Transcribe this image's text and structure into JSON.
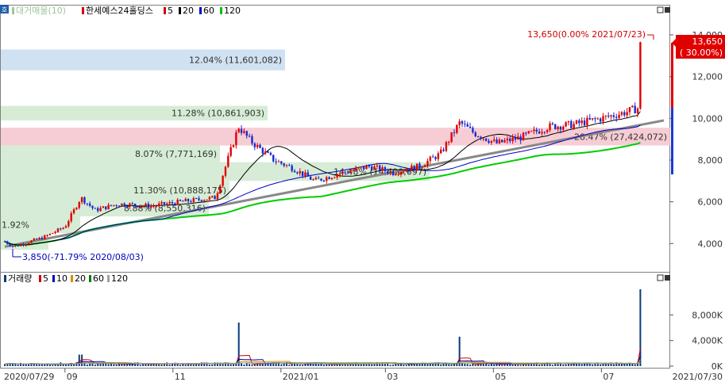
{
  "price_pane": {
    "legend": [
      {
        "label": "대거매물(10)",
        "color": "#9cc79c"
      },
      {
        "label": "한세예스24홀딩스",
        "color": "#d00000"
      },
      {
        "label": "5",
        "color": "#d00000"
      },
      {
        "label": "20",
        "color": "#000000"
      },
      {
        "label": "60",
        "color": "#0000c0"
      },
      {
        "label": "120",
        "color": "#00c000"
      }
    ],
    "badge": "호",
    "high_annotation": "13,650(0.00% 2021/07/23)",
    "low_annotation": "3,850(-71.79% 2020/08/03)",
    "last_price_box": {
      "price": "13,650",
      "change": "( 30.00%)"
    },
    "y_ticks": [
      "14,000",
      "12,000",
      "10,000",
      "8,000",
      "6,000",
      "4,000"
    ]
  },
  "volume_pane": {
    "legend": [
      {
        "label": "거래량",
        "color": "#0a3a7a"
      },
      {
        "label": "5",
        "color": "#d00000"
      },
      {
        "label": "10",
        "color": "#0000c0"
      },
      {
        "label": "20",
        "color": "#d09000"
      },
      {
        "label": "60",
        "color": "#008000"
      },
      {
        "label": "120",
        "color": "#a0a0a0"
      }
    ],
    "y_ticks": [
      "8,000K",
      "4,000K",
      "0K"
    ]
  },
  "x_axis": {
    "start": "2020/07/29",
    "end": "2021/07/30",
    "ticks": [
      "09",
      "11",
      "2021/01",
      "03",
      "05",
      "07"
    ]
  },
  "chart_data": {
    "type": "candlestick",
    "title": "한세예스24홀딩스",
    "y_range": [
      3500,
      14500
    ],
    "volume_profile": [
      {
        "label": "12.04% (11,601,082)",
        "low": 12300,
        "high": 13300
      },
      {
        "label": "11.28% (10,861,903)",
        "low": 9900,
        "high": 10600
      },
      {
        "label": "28.47% (27,424,072)",
        "low": 8700,
        "high": 9550
      },
      {
        "label": "8.07% (7,771,169)",
        "low": 7900,
        "high": 8700
      },
      {
        "label": "14.48% (14,490,697)",
        "low": 7000,
        "high": 7900
      },
      {
        "label": "11.30% (10,888,175)",
        "low": 6100,
        "high": 7000
      },
      {
        "label": "8.88% (8,550,316)",
        "low": 5300,
        "high": 6100
      },
      {
        "label": "1.92%",
        "low": 4500,
        "high": 5300
      },
      {
        "label": "",
        "low": 3700,
        "high": 4500
      }
    ],
    "close_series": [
      {
        "date": "2020-07-29",
        "close": 4100
      },
      {
        "date": "2020-08-03",
        "close": 3850
      },
      {
        "date": "2020-08-20",
        "close": 4300
      },
      {
        "date": "2020-09-01",
        "close": 4800
      },
      {
        "date": "2020-09-10",
        "close": 6200
      },
      {
        "date": "2020-09-18",
        "close": 5600
      },
      {
        "date": "2020-10-01",
        "close": 5900
      },
      {
        "date": "2020-10-20",
        "close": 5800
      },
      {
        "date": "2020-11-05",
        "close": 6000
      },
      {
        "date": "2020-11-25",
        "close": 6200
      },
      {
        "date": "2020-12-08",
        "close": 9600
      },
      {
        "date": "2020-12-15",
        "close": 8900
      },
      {
        "date": "2020-12-28",
        "close": 8000
      },
      {
        "date": "2021-01-08",
        "close": 7600
      },
      {
        "date": "2021-01-20",
        "close": 7000
      },
      {
        "date": "2021-02-05",
        "close": 7400
      },
      {
        "date": "2021-02-20",
        "close": 7700
      },
      {
        "date": "2021-03-05",
        "close": 7400
      },
      {
        "date": "2021-03-20",
        "close": 7700
      },
      {
        "date": "2021-04-01",
        "close": 8300
      },
      {
        "date": "2021-04-12",
        "close": 9800
      },
      {
        "date": "2021-04-20",
        "close": 9300
      },
      {
        "date": "2021-05-03",
        "close": 8800
      },
      {
        "date": "2021-05-17",
        "close": 9100
      },
      {
        "date": "2021-06-01",
        "close": 9600
      },
      {
        "date": "2021-06-15",
        "close": 9700
      },
      {
        "date": "2021-07-01",
        "close": 10000
      },
      {
        "date": "2021-07-15",
        "close": 10300
      },
      {
        "date": "2021-07-22",
        "close": 10500
      },
      {
        "date": "2021-07-23",
        "close": 13650
      }
    ],
    "volume_spikes": [
      {
        "date": "2020-09-10",
        "volume": 1800000
      },
      {
        "date": "2020-12-08",
        "volume": 6800000
      },
      {
        "date": "2021-04-12",
        "volume": 4600000
      },
      {
        "date": "2021-07-23",
        "volume": 12000000
      }
    ]
  }
}
